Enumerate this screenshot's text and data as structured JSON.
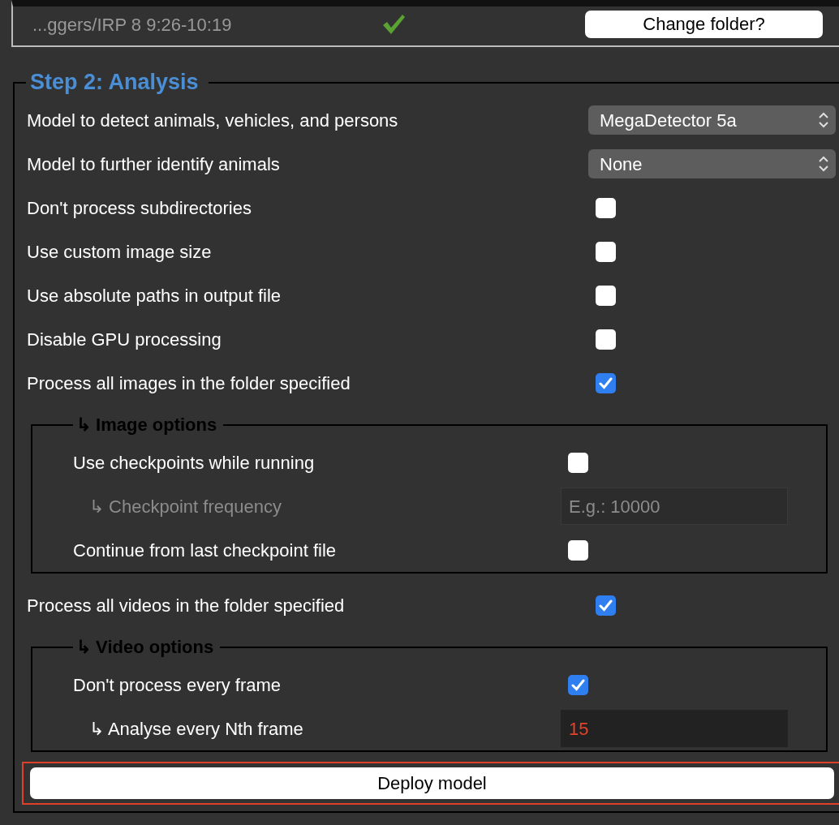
{
  "folder_bar": {
    "path": "...ggers/IRP 8 9:26-10:19",
    "valid": true,
    "button": "Change folder?"
  },
  "step2": {
    "title": "Step 2: Analysis",
    "rows": [
      {
        "kind": "select",
        "label": "Model to detect animals, vehicles, and persons",
        "value": "MegaDetector 5a"
      },
      {
        "kind": "select",
        "label": "Model to further identify animals",
        "value": "None"
      },
      {
        "kind": "checkbox",
        "label": "Don't process subdirectories",
        "checked": false
      },
      {
        "kind": "checkbox",
        "label": "Use custom image size",
        "checked": false
      },
      {
        "kind": "checkbox",
        "label": "Use absolute paths in output file",
        "checked": false
      },
      {
        "kind": "checkbox",
        "label": "Disable GPU processing",
        "checked": false
      },
      {
        "kind": "checkbox",
        "label": "Process all images in the folder specified",
        "checked": true
      },
      {
        "kind": "group",
        "title": "↳ Image options",
        "rows": [
          {
            "kind": "checkbox",
            "label": "Use checkpoints while running",
            "checked": false
          },
          {
            "kind": "entry",
            "label": "↳ Checkpoint frequency",
            "placeholder": "E.g.: 10000",
            "disabled": true
          },
          {
            "kind": "checkbox",
            "label": "Continue from last checkpoint file",
            "checked": false
          }
        ]
      },
      {
        "kind": "checkbox",
        "label": "Process all videos in the folder specified",
        "checked": true
      },
      {
        "kind": "group",
        "title": "↳ Video options",
        "rows": [
          {
            "kind": "checkbox",
            "label": "Don't process every frame",
            "checked": true
          },
          {
            "kind": "entry",
            "label": "↳ Analyse every Nth frame",
            "value": "15",
            "disabled": false
          }
        ]
      }
    ]
  },
  "deploy_button": "Deploy model"
}
